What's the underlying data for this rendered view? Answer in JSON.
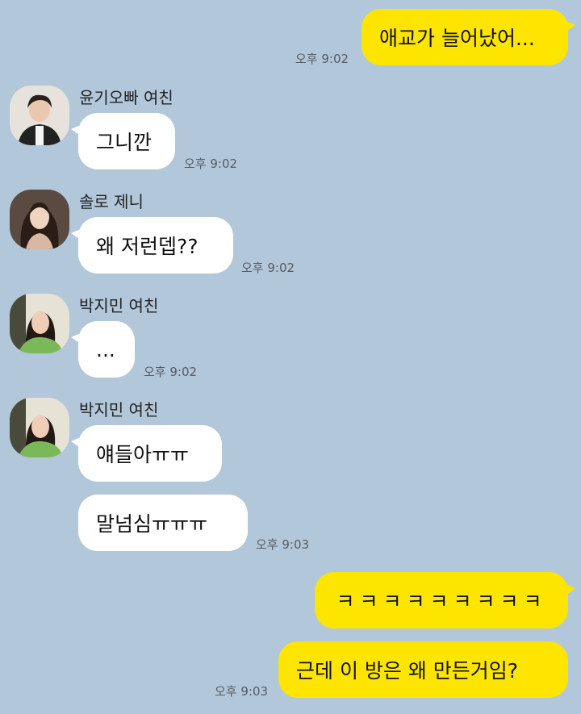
{
  "messages": {
    "m1": {
      "text": "애교가 늘어났어...",
      "time": "오후 9:02"
    },
    "m2": {
      "sender": "윤기오빠 여친",
      "text": "그니깐",
      "time": "오후 9:02"
    },
    "m3": {
      "sender": "솔로 제니",
      "text": "왜 저런뎁??",
      "time": "오후 9:02"
    },
    "m4": {
      "sender": "박지민 여친",
      "text": "...",
      "time": "오후 9:02"
    },
    "m5": {
      "sender": "박지민 여친",
      "text1": "얘들아ㅠㅠ",
      "text2": "말넘심ㅠㅠㅠ",
      "time": "오후 9:03"
    },
    "m6": {
      "text1": "ㅋㅋㅋㅋㅋㅋㅋㅋㅋ",
      "text2": "근데 이 방은 왜 만든거임?",
      "time": "오후 9:03"
    }
  },
  "colors": {
    "background": "#b2c7d9",
    "my_bubble": "#fee500",
    "other_bubble": "#ffffff"
  }
}
